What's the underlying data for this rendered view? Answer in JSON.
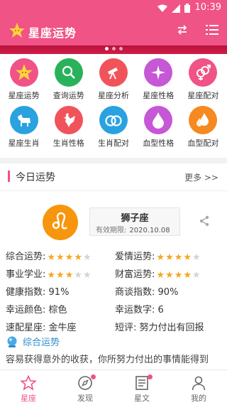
{
  "status_bar": {
    "time": "10:39"
  },
  "app_bar": {
    "title": "星座运势"
  },
  "carousel": {
    "count": 3,
    "active": 1
  },
  "grid": {
    "row1": [
      {
        "label": "星座运势",
        "color": "#f05386",
        "icon": "star-face-icon"
      },
      {
        "label": "查询运势",
        "color": "#2ab25a",
        "icon": "magnifier-icon"
      },
      {
        "label": "星座分析",
        "color": "#f0545a",
        "icon": "telescope-icon"
      },
      {
        "label": "星座性格",
        "color": "#c657d5",
        "icon": "sparkle-icon"
      },
      {
        "label": "星座配对",
        "color": "#f05386",
        "icon": "gender-icon"
      }
    ],
    "row2": [
      {
        "label": "星座生肖",
        "color": "#2aa2e0",
        "icon": "dog-icon"
      },
      {
        "label": "生肖性格",
        "color": "#f0545a",
        "icon": "rooster-icon"
      },
      {
        "label": "生肖配对",
        "color": "#2aa2e0",
        "icon": "rings-icon"
      },
      {
        "label": "血型性格",
        "color": "#c657d5",
        "icon": "drop-icon"
      },
      {
        "label": "血型配对",
        "color": "#f6891f",
        "icon": "drops-icon"
      }
    ]
  },
  "today": {
    "title": "今日运势",
    "more": "更多 >>"
  },
  "sign": {
    "name": "狮子座",
    "valid_label": "有效期限:",
    "valid_date": "2020.10.08",
    "color": "#f7960d"
  },
  "info": {
    "composite_label": "综合运势:",
    "composite_stars": 4,
    "love_label": "爱情运势:",
    "love_stars": 4,
    "career_label": "事业学业:",
    "career_stars": 3,
    "wealth_label": "财富运势:",
    "wealth_stars": 4,
    "health_label": "健康指数:",
    "health_value": "91%",
    "negotiation_label": "商谈指数:",
    "negotiation_value": "90%",
    "lucky_color_label": "幸运颜色:",
    "lucky_color_value": "棕色",
    "lucky_number_label": "幸运数字:",
    "lucky_number_value": "6",
    "match_label": "速配星座:",
    "match_value": "金牛座",
    "comment_label": "短评:",
    "comment_value": "努力付出有回报"
  },
  "composite_section": {
    "title": "综合运势",
    "text": "容易获得意外的收获，你所努力付出的事情能得到"
  },
  "tabs": [
    {
      "label": "星座",
      "active": true,
      "badge": false
    },
    {
      "label": "发现",
      "active": false,
      "badge": true
    },
    {
      "label": "星文",
      "active": false,
      "badge": true
    },
    {
      "label": "我的",
      "active": false,
      "badge": false
    }
  ],
  "colors": {
    "brand": "#f05386",
    "star": "#f5a623",
    "link": "#2e8ecc"
  }
}
